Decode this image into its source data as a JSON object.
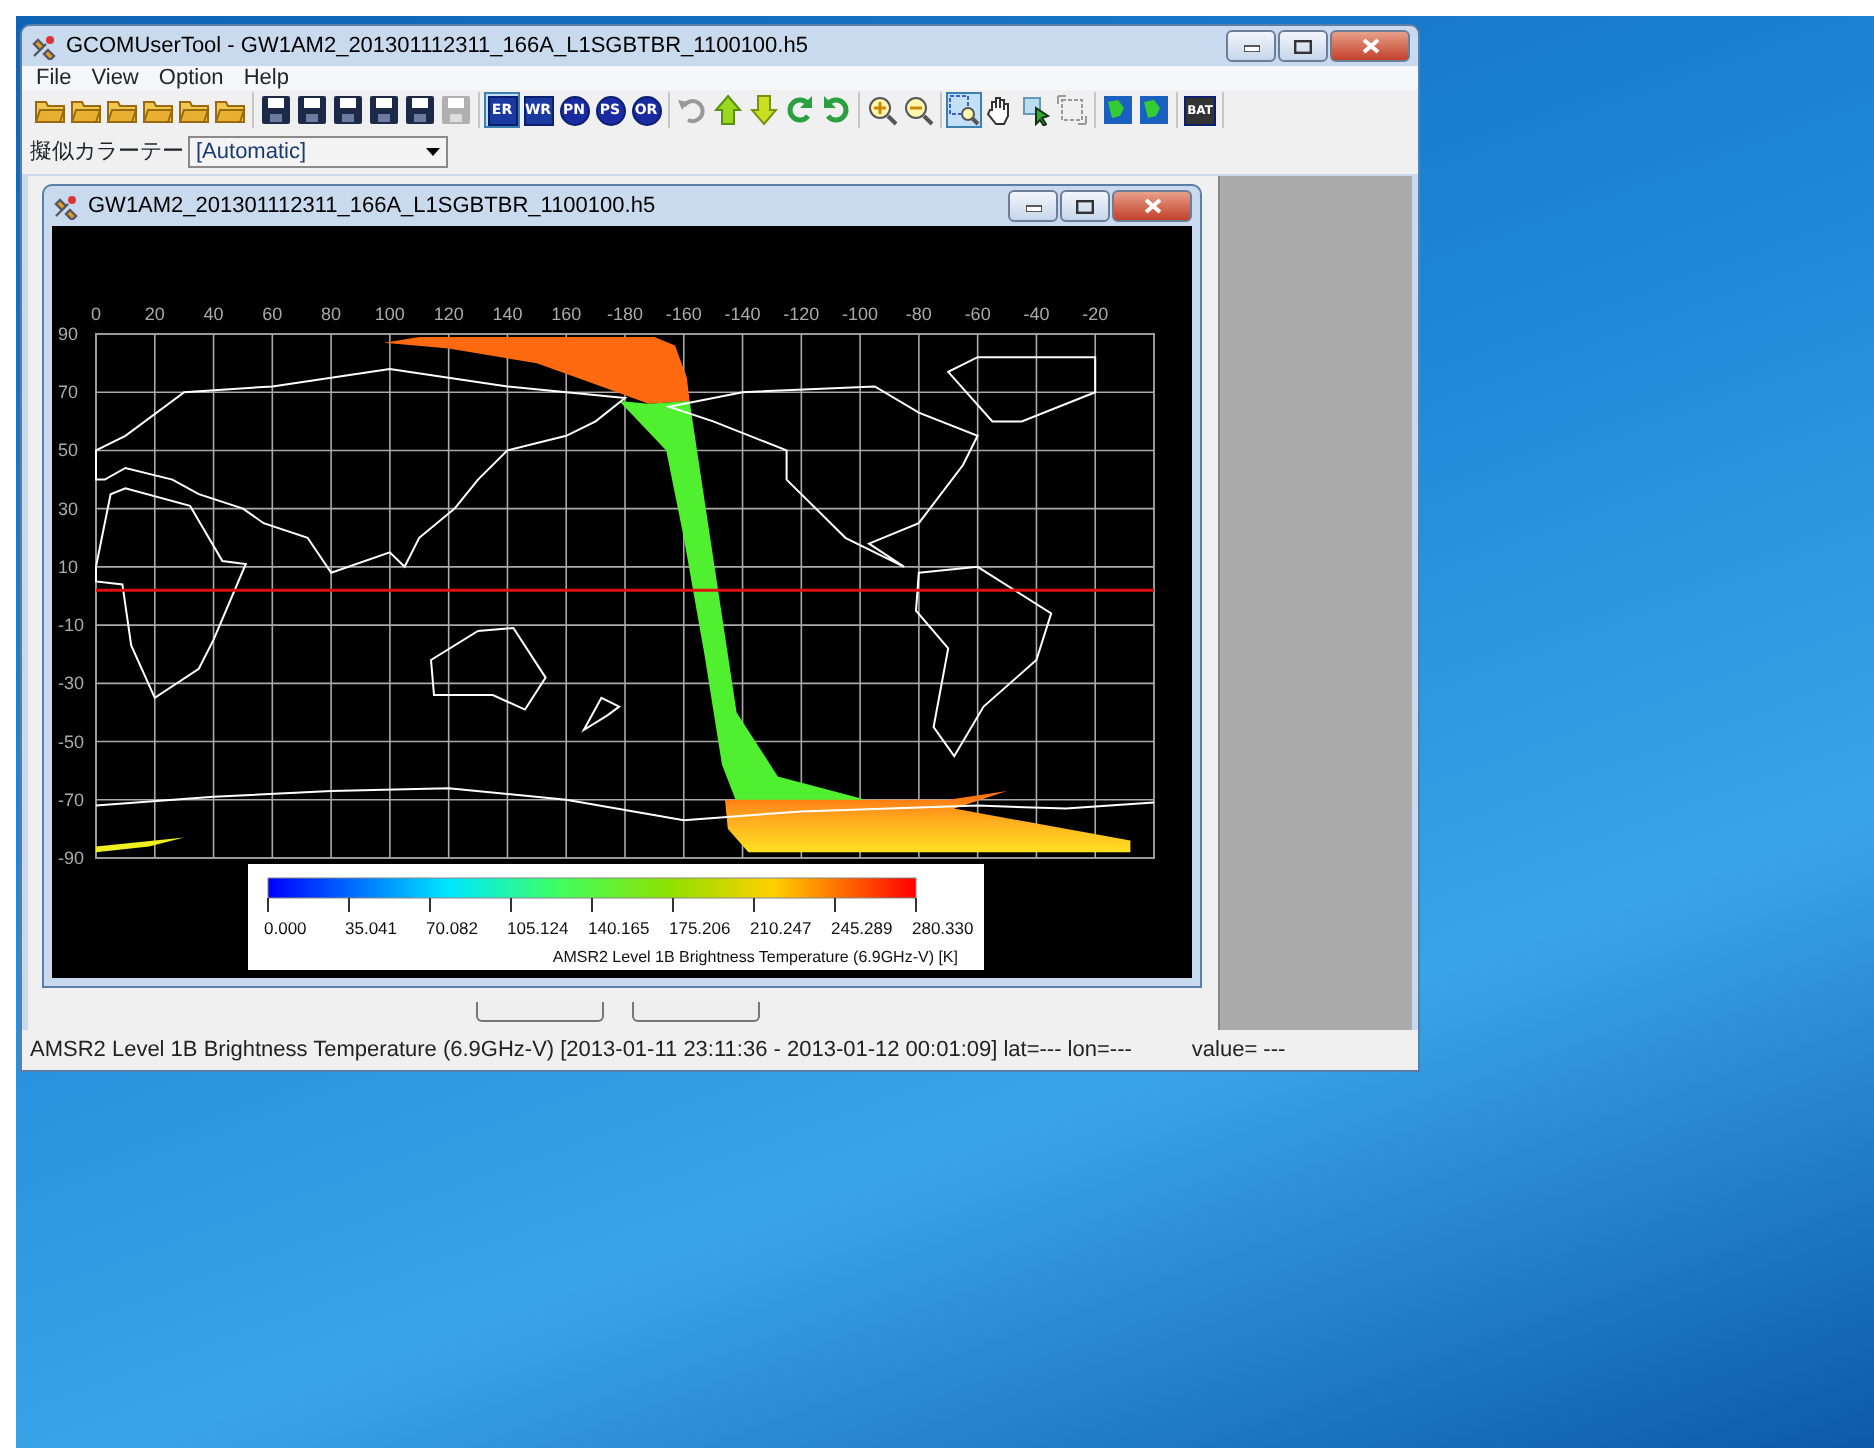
{
  "window": {
    "title": "GCOMUserTool - GW1AM2_201301112311_166A_L1SGBTBR_1100100.h5"
  },
  "menu": [
    "File",
    "View",
    "Option",
    "Help"
  ],
  "toolbar": [
    [
      {
        "kind": "open"
      },
      {
        "kind": "open"
      },
      {
        "kind": "open"
      },
      {
        "kind": "open"
      },
      {
        "kind": "open"
      },
      {
        "kind": "open"
      }
    ],
    [
      {
        "kind": "save",
        "disabled": false
      },
      {
        "kind": "save",
        "disabled": false
      },
      {
        "kind": "save",
        "disabled": false
      },
      {
        "kind": "save",
        "disabled": false
      },
      {
        "kind": "save",
        "disabled": false
      },
      {
        "kind": "save",
        "disabled": true
      }
    ],
    [
      {
        "kind": "square-label",
        "label": "ER",
        "selected": true
      },
      {
        "kind": "square-label",
        "label": "WR",
        "selected": false
      },
      {
        "kind": "round-label",
        "label": "PN",
        "selected": false
      },
      {
        "kind": "round-label",
        "label": "PS",
        "selected": false
      },
      {
        "kind": "round-label",
        "label": "OR",
        "selected": false
      }
    ],
    [
      {
        "kind": "undo"
      },
      {
        "kind": "up"
      },
      {
        "kind": "down"
      },
      {
        "kind": "rotate-left"
      },
      {
        "kind": "rotate-right"
      }
    ],
    [
      {
        "kind": "zoom-in"
      },
      {
        "kind": "zoom-out"
      }
    ],
    [
      {
        "kind": "select",
        "selected": true
      },
      {
        "kind": "pan",
        "selected": false
      },
      {
        "kind": "pick",
        "selected": false
      },
      {
        "kind": "fit",
        "selected": false
      }
    ],
    [
      {
        "kind": "map"
      },
      {
        "kind": "map"
      }
    ],
    [
      {
        "kind": "square-label",
        "label": "BAT",
        "selected": false
      }
    ]
  ],
  "color_table": {
    "label": "擬似カラーテー",
    "value": "[Automatic]"
  },
  "child_window": {
    "title": "GW1AM2_201301112311_166A_L1SGBTBR_1100100.h5"
  },
  "map": {
    "x_ticks": [
      "0",
      "20",
      "40",
      "60",
      "80",
      "100",
      "120",
      "140",
      "160",
      "-180",
      "-160",
      "-140",
      "-120",
      "-100",
      "-80",
      "-60",
      "-40",
      "-20"
    ],
    "y_ticks": [
      "90",
      "70",
      "50",
      "30",
      "10",
      "-10",
      "-30",
      "-50",
      "-70",
      "-90"
    ]
  },
  "colorbar": {
    "ticks": [
      "0.000",
      "35.041",
      "70.082",
      "105.124",
      "140.165",
      "175.206",
      "210.247",
      "245.289",
      "280.330"
    ],
    "title": "AMSR2 Level 1B Brightness Temperature (6.9GHz-V) [K]"
  },
  "status_bar": {
    "text": "AMSR2 Level 1B Brightness Temperature (6.9GHz-V) [2013-01-11 23:11:36 - 2013-01-12 00:01:09] lat=--- lon=---",
    "value": "value= ---"
  }
}
